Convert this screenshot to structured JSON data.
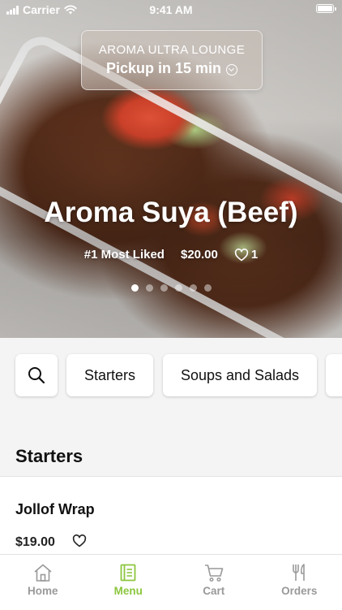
{
  "status_bar": {
    "carrier": "Carrier",
    "time": "9:41 AM"
  },
  "pickup": {
    "restaurant": "AROMA ULTRA LOUNGE",
    "pickup_text": "Pickup in 15 min"
  },
  "featured": {
    "title": "Aroma Suya (Beef)",
    "badge": "#1 Most Liked",
    "price": "$20.00",
    "likes": "1",
    "carousel_pages": 6,
    "carousel_active": 0
  },
  "categories": {
    "items": [
      "Starters",
      "Soups and Salads"
    ]
  },
  "section": {
    "title": "Starters"
  },
  "menu_items": [
    {
      "name": "Jollof Wrap",
      "price": "$19.00"
    }
  ],
  "tabs": [
    {
      "label": "Home",
      "icon": "home-icon",
      "active": false
    },
    {
      "label": "Menu",
      "icon": "menu-book-icon",
      "active": true
    },
    {
      "label": "Cart",
      "icon": "cart-icon",
      "active": false
    },
    {
      "label": "Orders",
      "icon": "fork-knife-icon",
      "active": false
    }
  ],
  "colors": {
    "accent": "#8cc63e",
    "inactive_tab": "#999999",
    "background": "#f4f4f4"
  }
}
